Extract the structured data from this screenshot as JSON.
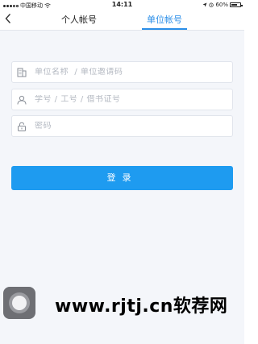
{
  "status_bar": {
    "carrier": "中国移动",
    "time": "14:11",
    "battery": "60%",
    "battery_level": 0.6
  },
  "nav": {
    "back_icon": "chevron-left-icon",
    "tabs": [
      {
        "label": "个人帐号",
        "active": false
      },
      {
        "label": "单位帐号",
        "active": true
      }
    ],
    "active_color": "#2a8ee8"
  },
  "form": {
    "org": {
      "placeholder": "单位名称  / 单位邀请码",
      "value": "",
      "icon": "building-icon"
    },
    "id": {
      "placeholder": "学号 / 工号 / 借书证号",
      "value": "",
      "icon": "user-icon"
    },
    "password": {
      "placeholder": "密码",
      "value": "",
      "icon": "lock-icon"
    },
    "submit_label": "登录",
    "submit_color": "#1e9bf0"
  },
  "watermark": {
    "text": "www.rjtj.cn软荐网"
  }
}
